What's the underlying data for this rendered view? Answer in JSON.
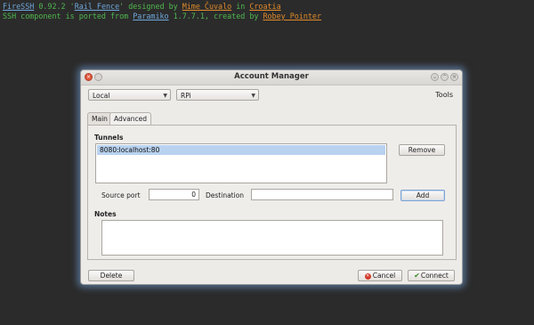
{
  "terminal": {
    "line1": {
      "app": "FireSSH",
      "version": " 0.92.2 '",
      "theme": "Rail Fence",
      "by": "' designed by ",
      "designer": "Mime Čuvalo",
      "in": " in ",
      "country": "Croatia"
    },
    "line2": {
      "prefix": "SSH component is ported from ",
      "lib": "Paramiko",
      "mid": " 1.7.7.1, created by ",
      "author": "Robey Pointer"
    }
  },
  "dialog": {
    "title": "Account Manager",
    "location_combo": "Local",
    "account_combo": "RPi",
    "tools_label": "Tools",
    "tabs": [
      {
        "label": "Main",
        "active": false
      },
      {
        "label": "Advanced",
        "active": true
      }
    ],
    "tunnels": {
      "heading": "Tunnels",
      "items": [
        "8080:localhost:80"
      ],
      "remove_label": "Remove",
      "source_port_label": "Source port",
      "source_port_value": "0",
      "destination_label": "Destination",
      "destination_value": "",
      "add_label": "Add"
    },
    "notes": {
      "heading": "Notes",
      "value": ""
    },
    "buttons": {
      "delete": "Delete",
      "cancel": "Cancel",
      "connect": "Connect"
    }
  },
  "colors": {
    "background": "#2b2b2b",
    "terminal_text": "#4fb84f",
    "link_orange": "#e08a2b",
    "selection": "#b9d2ef",
    "dialog_glow": "#78aae6"
  }
}
